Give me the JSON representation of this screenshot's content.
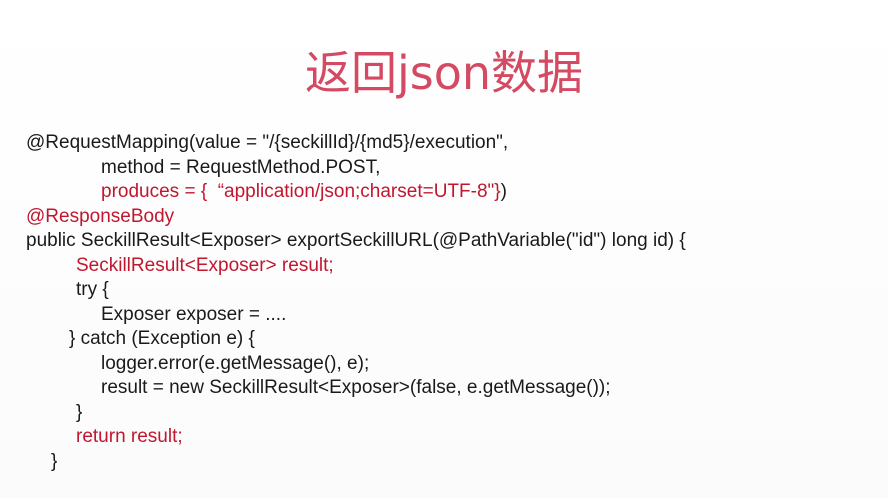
{
  "title": "返回json数据",
  "code": {
    "l1": "@RequestMapping(value = \"/{seckillId}/{md5}/execution\",",
    "l2": "method = RequestMethod.POST,",
    "l3_red": "produces = {  “application/json;charset=UTF-8\"}",
    "l3_tail": ")",
    "l4": "@ResponseBody",
    "l5": "public SeckillResult<Exposer> exportSeckillURL(@PathVariable(\"id\") long id) {",
    "l6": "SeckillResult<Exposer> result;",
    "l7": "try {",
    "l8": "Exposer exposer = ....",
    "l9": "} catch (Exception e) {",
    "l10": "logger.error(e.getMessage(), e);",
    "l11": "result = new SeckillResult<Exposer>(false, e.getMessage());",
    "l12": "}",
    "l13": "return result;",
    "l14": "}"
  },
  "colors": {
    "title": "#d44a63",
    "highlight": "#c0172f",
    "text": "#1a1a1a"
  }
}
